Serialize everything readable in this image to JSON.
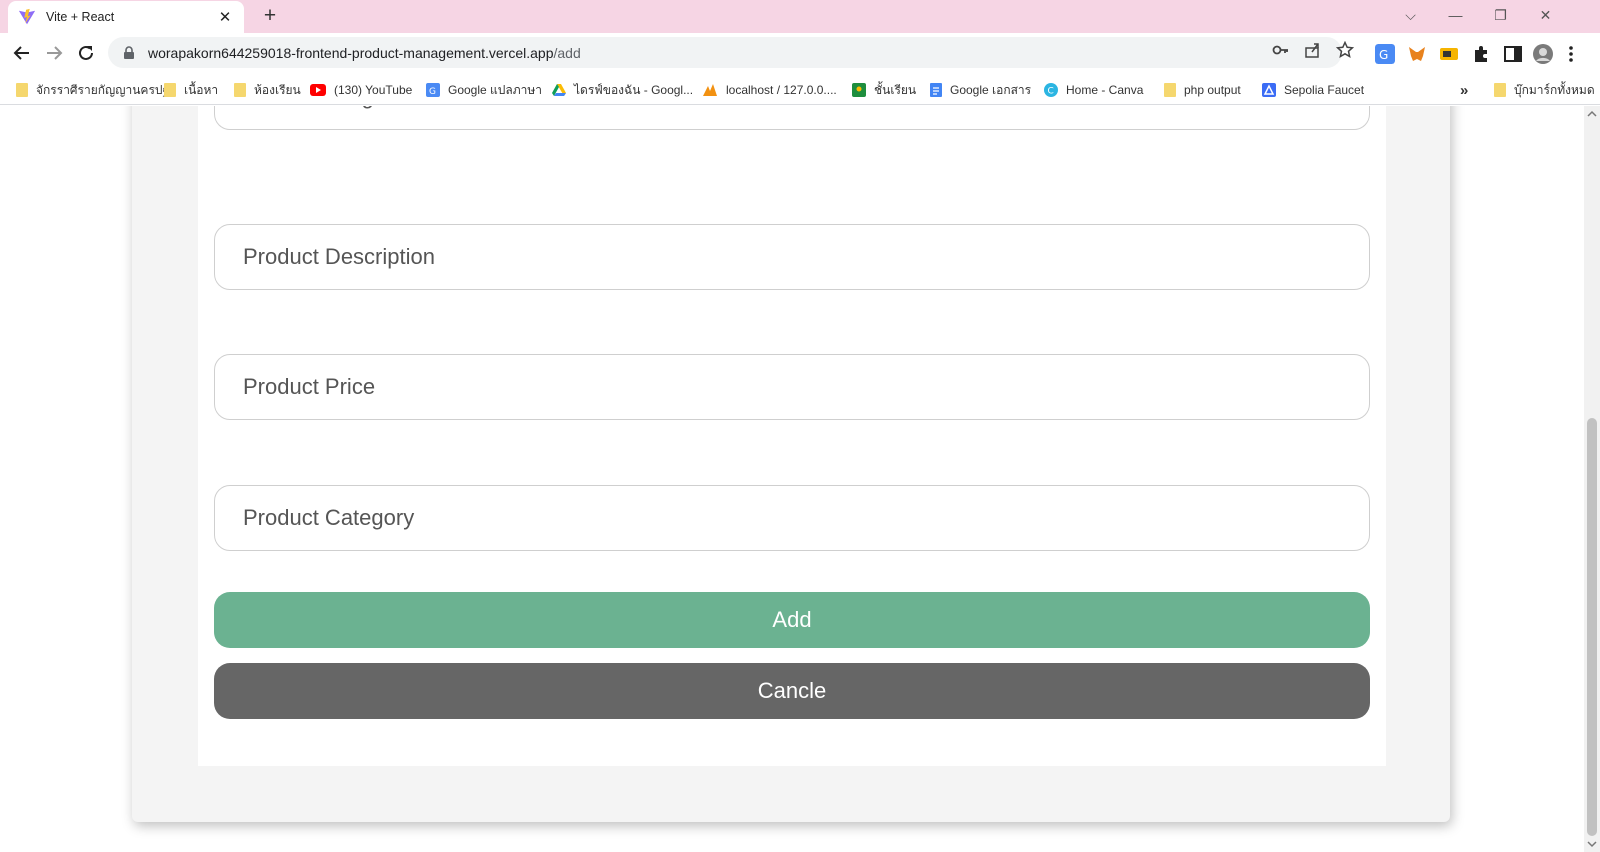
{
  "tab": {
    "title": "Vite + React",
    "close": "✕",
    "new_tab": "+"
  },
  "window": {
    "chevron": "⌵",
    "minimize": "—",
    "restore": "❐",
    "close": "✕"
  },
  "address": {
    "host": "worapakorn644259018-frontend-product-management.vercel.app",
    "path": "/add"
  },
  "bookmarks": {
    "items": [
      {
        "label": "จักรราศีรายกัญญานครปฐม",
        "icon": "folder-icon"
      },
      {
        "label": "เนื้อหา",
        "icon": "folder-icon"
      },
      {
        "label": "ห้องเรียน",
        "icon": "folder-icon"
      },
      {
        "label": "(130) YouTube",
        "icon": "youtube-icon"
      },
      {
        "label": "Google แปลภาษา",
        "icon": "translate-icon"
      },
      {
        "label": "ไดรฟ์ของฉัน - Googl...",
        "icon": "drive-icon"
      },
      {
        "label": "localhost / 127.0.0....",
        "icon": "phpmyadmin-icon"
      },
      {
        "label": "ชั้นเรียน",
        "icon": "classroom-icon"
      },
      {
        "label": "Google เอกสาร",
        "icon": "docs-icon"
      },
      {
        "label": "Home - Canva",
        "icon": "canva-icon"
      },
      {
        "label": "php output",
        "icon": "folder-icon"
      },
      {
        "label": "Sepolia Faucet",
        "icon": "sepolia-icon"
      }
    ],
    "overflow": "»",
    "all_bookmarks": "บุ๊กมาร์กทั้งหมด"
  },
  "form": {
    "image_path_placeholder": "Product Image Path",
    "description_placeholder": "Product Description",
    "price_placeholder": "Product Price",
    "category_placeholder": "Product Category",
    "add_label": "Add",
    "cancel_label": "Cancle"
  },
  "colors": {
    "add": "#6bb291",
    "cancel": "#666666",
    "tabstrip": "#f6d5e4"
  }
}
